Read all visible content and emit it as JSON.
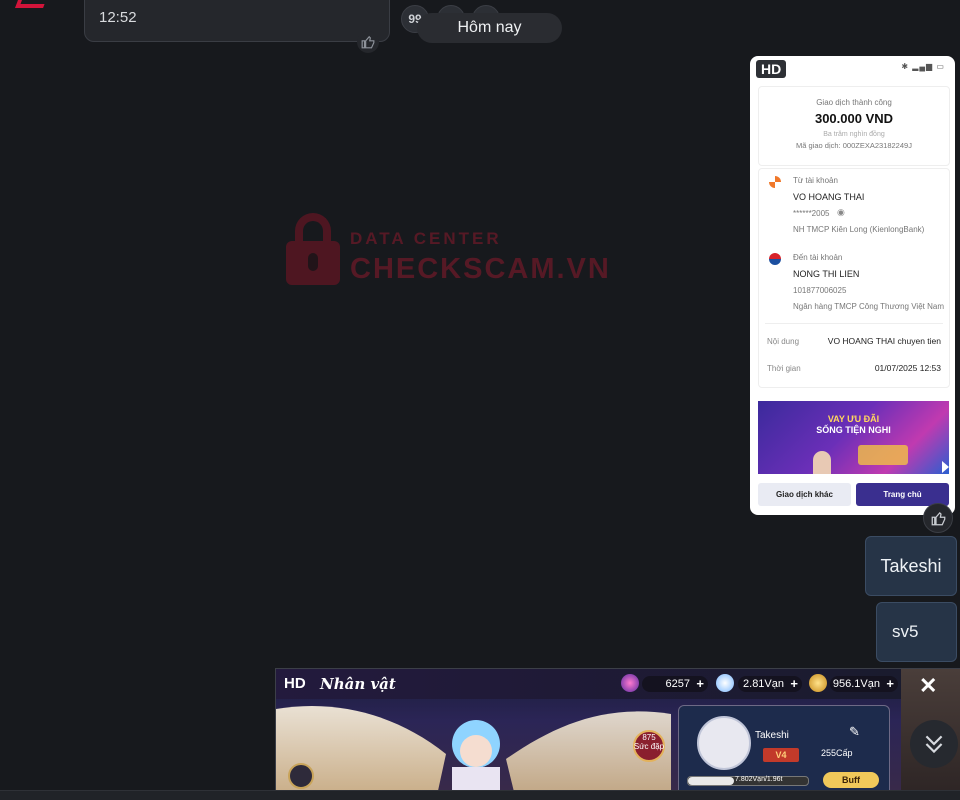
{
  "top_message": {
    "time": "12:52"
  },
  "date_divider": "Hôm nay",
  "reaction_glyph": "99",
  "watermark": {
    "line1": "DATA CENTER",
    "line2": "CHECKSCAM.VN"
  },
  "receipt": {
    "hd_badge": "HD",
    "status_text": "Giao dịch thành công",
    "amount": "300.000 VND",
    "amount_words": "Ba trăm nghìn đồng",
    "transaction_id": "Mã giao dịch: 000ZEXA23182249J",
    "from": {
      "label": "Từ tài khoản",
      "name": "VO HOANG THAI",
      "account": "******2005",
      "bank": "NH TMCP Kiên Long (KienlongBank)"
    },
    "to": {
      "label": "Đến tài khoản",
      "name": "NONG THI LIEN",
      "account": "101877006025",
      "bank": "Ngân hàng TMCP Công Thương Việt Nam"
    },
    "content_label": "Nội dung",
    "content_value": "VO HOANG THAI chuyen tien",
    "time_label": "Thời gian",
    "time_value": "01/07/2025 12:53",
    "banner_line1": "VAY ƯU ĐÃI",
    "banner_line2": "SỐNG TIỆN NGHI",
    "btn_other": "Giao dịch khác",
    "btn_home": "Trang chủ"
  },
  "messages": [
    {
      "text": "Takeshi"
    },
    {
      "text": "sv5"
    }
  ],
  "game": {
    "hd_badge": "HD",
    "title": "Nhân vật",
    "res1": "6257",
    "res2": "2.81Vạn",
    "res3": "956.1Vạn",
    "level_badge": "875",
    "level_sub": "Sức đặp",
    "player_name": "Takeshi",
    "vip": "V4",
    "level": "255Cấp",
    "exp_text": "7.802Vạn/1.96t",
    "exp_progress": 0.38,
    "buff": "Buff"
  },
  "colors": {
    "background": "#17191d",
    "bubble": "#263447",
    "accent_red": "#d2143a"
  }
}
